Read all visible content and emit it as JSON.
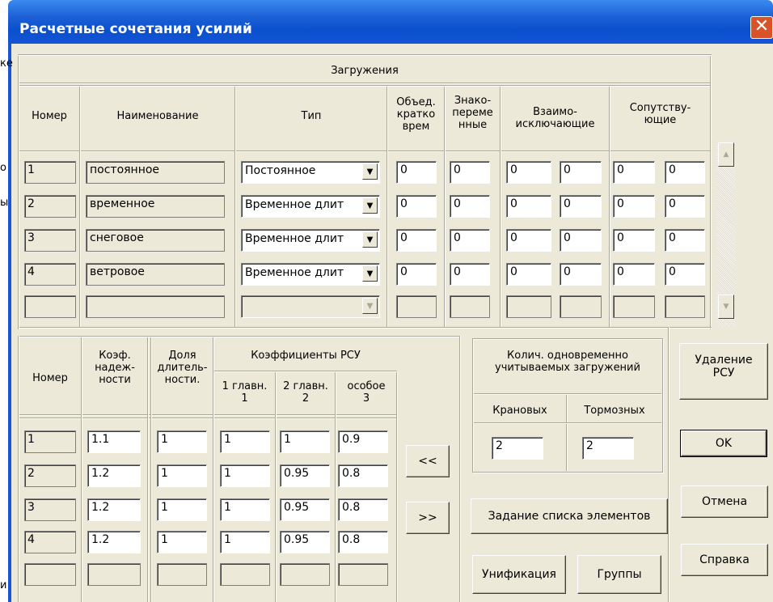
{
  "window": {
    "title": "Расчетные сочетания усилий",
    "close_glyph": "✕"
  },
  "edge_chars": {
    "e1": "ке",
    "e2": "о",
    "e3": "ы",
    "e4": "и"
  },
  "loads": {
    "group_title": "Загружения",
    "headers": {
      "number": "Номер",
      "name": "Наименование",
      "type": "Тип",
      "combined": [
        "Объед.",
        "кратко",
        "врем"
      ],
      "alternating": [
        "Знако-",
        "переме",
        "нные"
      ],
      "exclusive": [
        "Взаимо-",
        "исключающие"
      ],
      "accompanying": [
        "Сопутству-",
        "ющие"
      ]
    },
    "rows": [
      {
        "num": "1",
        "name": "постоянное",
        "type": "Постоянное",
        "comb": "0",
        "alt": "0",
        "ex1": "0",
        "ex2": "0",
        "ac1": "0",
        "ac2": "0"
      },
      {
        "num": "2",
        "name": "временное",
        "type": "Временное длит",
        "comb": "0",
        "alt": "0",
        "ex1": "0",
        "ex2": "0",
        "ac1": "0",
        "ac2": "0"
      },
      {
        "num": "3",
        "name": "снеговое",
        "type": "Временное длит",
        "comb": "0",
        "alt": "0",
        "ex1": "0",
        "ex2": "0",
        "ac1": "0",
        "ac2": "0"
      },
      {
        "num": "4",
        "name": "ветровое",
        "type": "Временное длит",
        "comb": "0",
        "alt": "0",
        "ex1": "0",
        "ex2": "0",
        "ac1": "0",
        "ac2": "0"
      }
    ]
  },
  "rsu": {
    "headers": {
      "number": "Номер",
      "reliability": [
        "Коэф.",
        "надеж-",
        "ности"
      ],
      "duration": [
        "Доля",
        "длитель-",
        "ности."
      ],
      "coefs": "Коэффициенты РСУ",
      "main1": [
        "1 главн.",
        "1"
      ],
      "main2": [
        "2 главн.",
        "2"
      ],
      "special": [
        "особое",
        "3"
      ]
    },
    "rows": [
      {
        "num": "1",
        "rel": "1.1",
        "dur": "1",
        "c1": "1",
        "c2": "1",
        "c3": "0.9"
      },
      {
        "num": "2",
        "rel": "1.2",
        "dur": "1",
        "c1": "1",
        "c2": "0.95",
        "c3": "0.8"
      },
      {
        "num": "3",
        "rel": "1.2",
        "dur": "1",
        "c1": "1",
        "c2": "0.95",
        "c3": "0.8"
      },
      {
        "num": "4",
        "rel": "1.2",
        "dur": "1",
        "c1": "1",
        "c2": "0.95",
        "c3": "0.8"
      }
    ],
    "btn_left": "<<",
    "btn_right": ">>"
  },
  "simultaneous": {
    "title": [
      "Колич. одновременно",
      "учитываемых загружений"
    ],
    "crane_label": "Крановых",
    "brake_label": "Тормозных",
    "crane_value": "2",
    "brake_value": "2"
  },
  "buttons": {
    "element_list": "Задание списка элементов",
    "unify": "Унификация",
    "groups": "Группы",
    "delete_rsu": [
      "Удаление",
      "РСУ"
    ],
    "ok": "OK",
    "cancel": "Отмена",
    "help": "Справка"
  }
}
